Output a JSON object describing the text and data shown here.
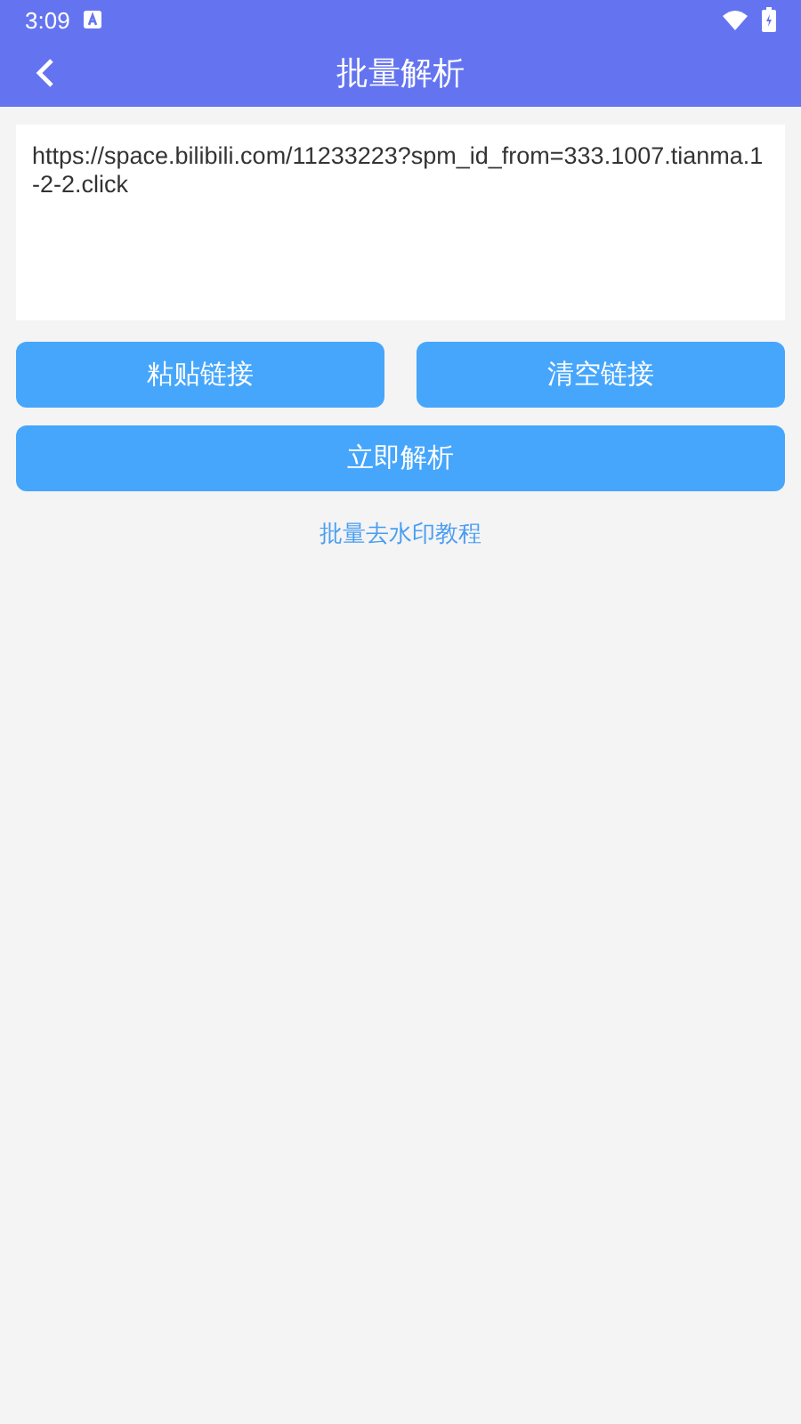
{
  "status_bar": {
    "time": "3:09"
  },
  "header": {
    "title": "批量解析"
  },
  "link_field": {
    "value": "https://space.bilibili.com/11233223?spm_id_from=333.1007.tianma.1-2-2.click"
  },
  "buttons": [
    {
      "label": "粘贴链接"
    },
    {
      "label": "清空链接"
    }
  ],
  "primary_button": {
    "label": "立即解析"
  },
  "tutorial_link": "批量去水印教程"
}
